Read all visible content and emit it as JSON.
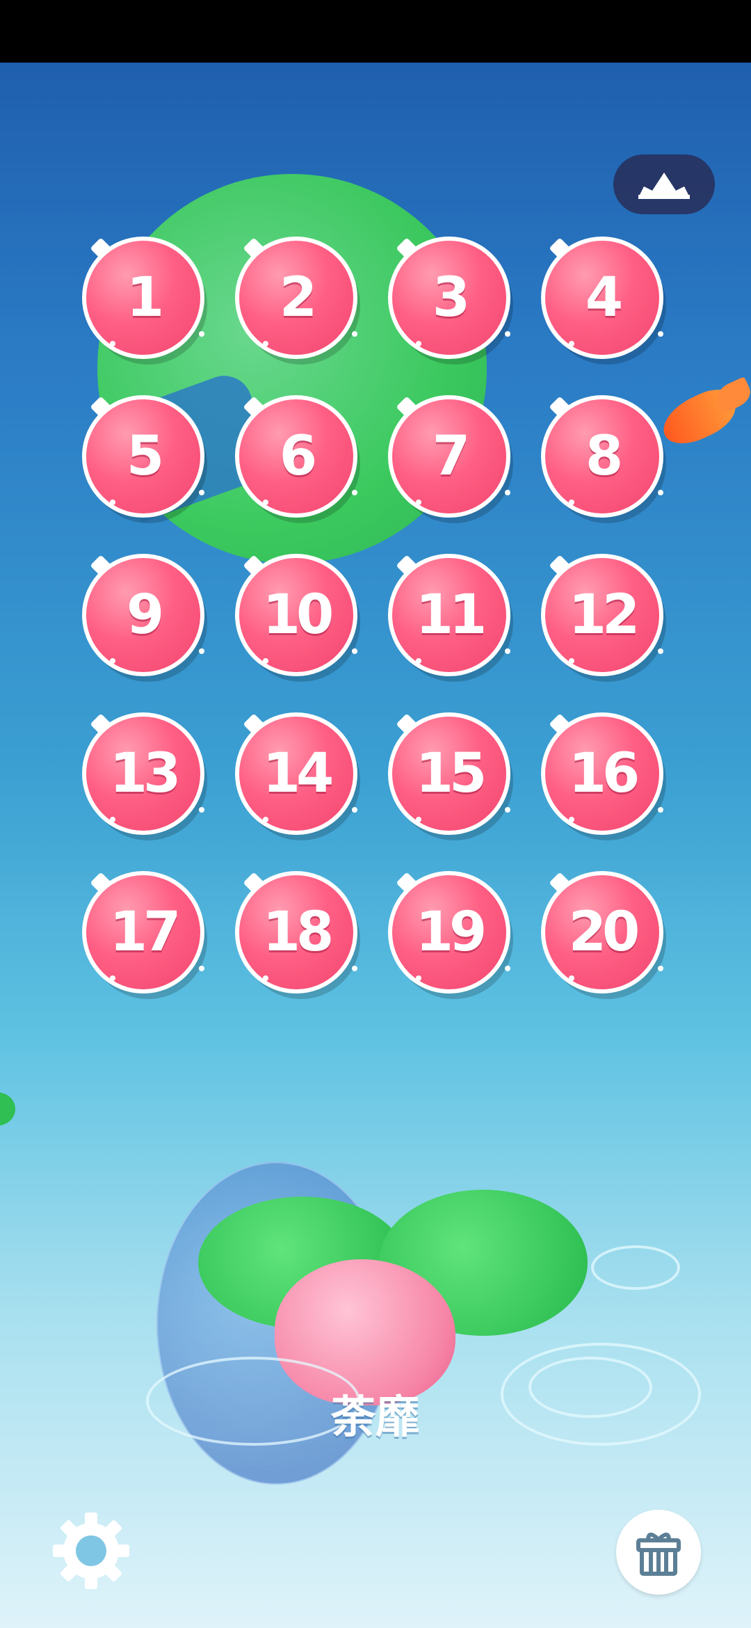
{
  "levels": [
    "1",
    "2",
    "3",
    "4",
    "5",
    "6",
    "7",
    "8",
    "9",
    "10",
    "11",
    "12",
    "13",
    "14",
    "15",
    "16",
    "17",
    "18",
    "19",
    "20"
  ],
  "feature": {
    "flower_name": "荼靡"
  },
  "icons": {
    "top_right": "crown-icon",
    "bottom_left": "gear-icon",
    "bottom_right": "gift-box-icon"
  },
  "colors": {
    "level_bubble": "#f24670",
    "level_border": "#ffffff",
    "background_top": "#1f5fae",
    "background_bottom": "#dff3fa",
    "lilypad": "#3ccf55"
  }
}
